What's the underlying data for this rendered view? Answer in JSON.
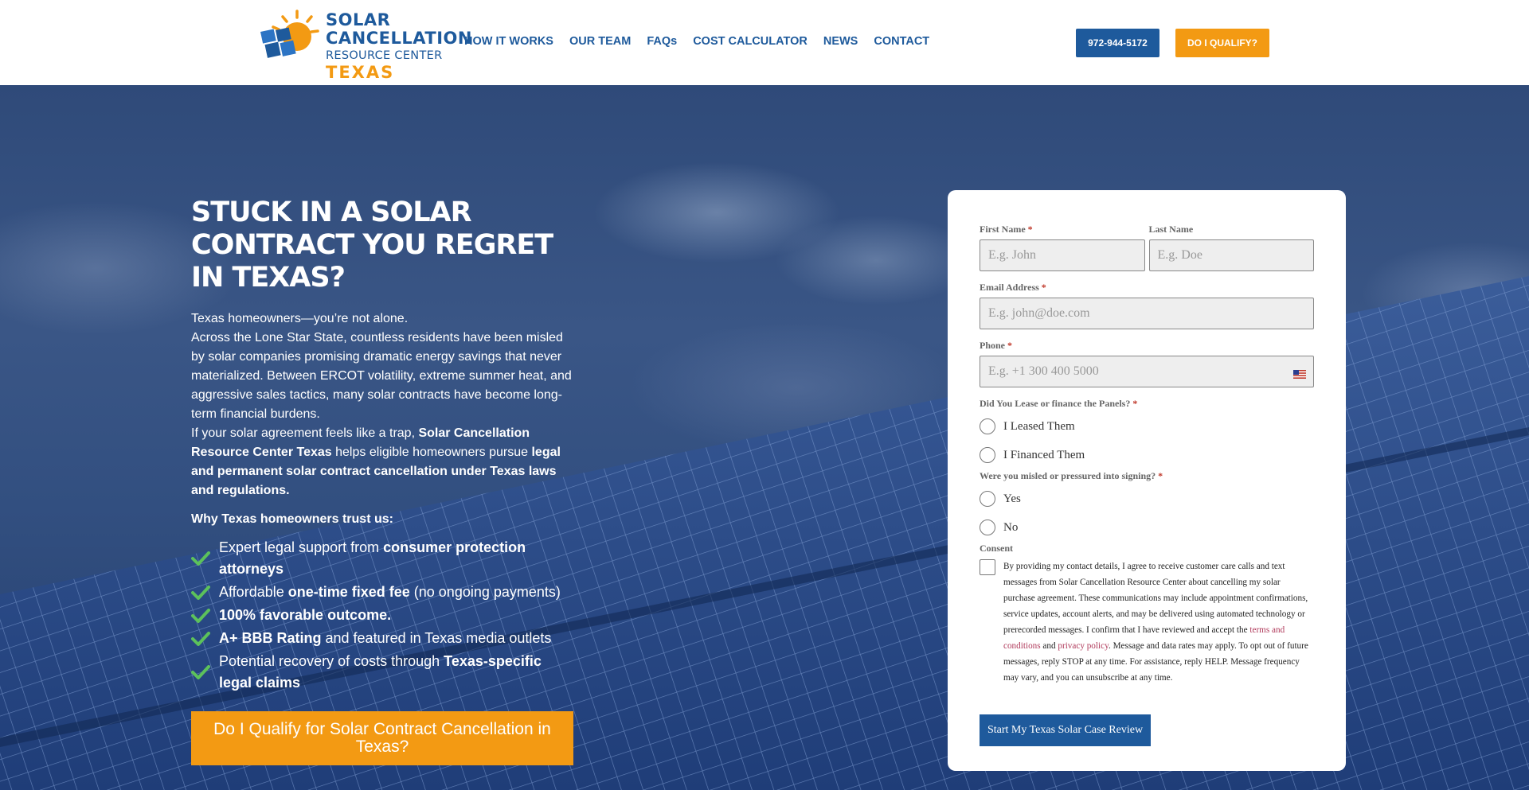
{
  "brand": {
    "line1": "SOLAR",
    "line2": "CANCELLATION",
    "line3": "RESOURCE CENTER",
    "line4": "TEXAS",
    "colors": {
      "blue": "#1e5a9c",
      "orange": "#f39a13"
    }
  },
  "nav": {
    "items": [
      {
        "label": "HOW IT WORKS"
      },
      {
        "label": "OUR TEAM"
      },
      {
        "label": "FAQs"
      },
      {
        "label": "COST CALCULATOR"
      },
      {
        "label": "NEWS"
      },
      {
        "label": "CONTACT"
      }
    ],
    "phone_label": "972-944-5172",
    "qualify_label": "DO I QUALIFY?"
  },
  "hero": {
    "title": "STUCK IN A SOLAR CONTRACT YOU REGRET IN TEXAS?",
    "p1": "Texas homeowners—you’re not alone.",
    "p2": "Across the Lone Star State, countless residents have been misled by solar companies promising dramatic energy savings that never materialized. Between ERCOT volatility, extreme summer heat, and aggressive sales tactics, many solar contracts have become long-term financial burdens.",
    "p3_a": "If your solar agreement feels like a trap, ",
    "p3_b": "Solar Cancellation Resource Center Texas",
    "p3_c": " helps eligible homeowners pursue ",
    "p3_d": "legal and permanent solar contract cancellation under Texas laws and regulations.",
    "why_title": "Why Texas homeowners trust us:",
    "bullets": [
      {
        "a": "Expert legal support from ",
        "b": "consumer protection attorneys",
        "c": ""
      },
      {
        "a": "Affordable ",
        "b": "one-time fixed fee",
        "c": " (no ongoing payments)"
      },
      {
        "a": "",
        "b": "100% favorable outcome.",
        "c": ""
      },
      {
        "a": "",
        "b": "A+ BBB Rating",
        "c": " and featured in Texas media outlets"
      },
      {
        "a": "Potential recovery of costs through ",
        "b": "Texas-specific legal claims",
        "c": ""
      }
    ],
    "cta_label": "Do I Qualify for Solar Contract Cancellation in Texas?"
  },
  "form": {
    "first_name_label": "First Name",
    "first_name_placeholder": "E.g. John",
    "last_name_label": "Last Name",
    "last_name_placeholder": "E.g. Doe",
    "email_label": "Email Address",
    "email_placeholder": "E.g. john@doe.com",
    "phone_label": "Phone",
    "phone_placeholder": "E.g. +1 300 400 5000",
    "q1_label": "Did You Lease or finance the Panels?",
    "q1_options": [
      "I Leased Them",
      "I Financed Them"
    ],
    "q2_label": "Were you misled or pressured into signing?",
    "q2_options": [
      "Yes",
      "No"
    ],
    "consent_label": "Consent",
    "consent_a": "By providing my contact details, I agree to receive customer care calls and text messages from Solar Cancellation Resource Center about cancelling my solar purchase agreement. These communications may include appointment confirmations, service updates, account alerts, and may be delivered using automated technology or prerecorded messages. I confirm that I have reviewed and accept the ",
    "terms_link": "terms and conditions",
    "consent_and": " and ",
    "privacy_link": "privacy policy",
    "consent_b": ". Message and data rates may apply. To opt out of future messages, reply STOP at any time. For assistance, reply HELP. Message frequency may vary, and you can unsubscribe at any time.",
    "required_mark": "*",
    "submit_label": "Start My Texas Solar Case Review"
  }
}
